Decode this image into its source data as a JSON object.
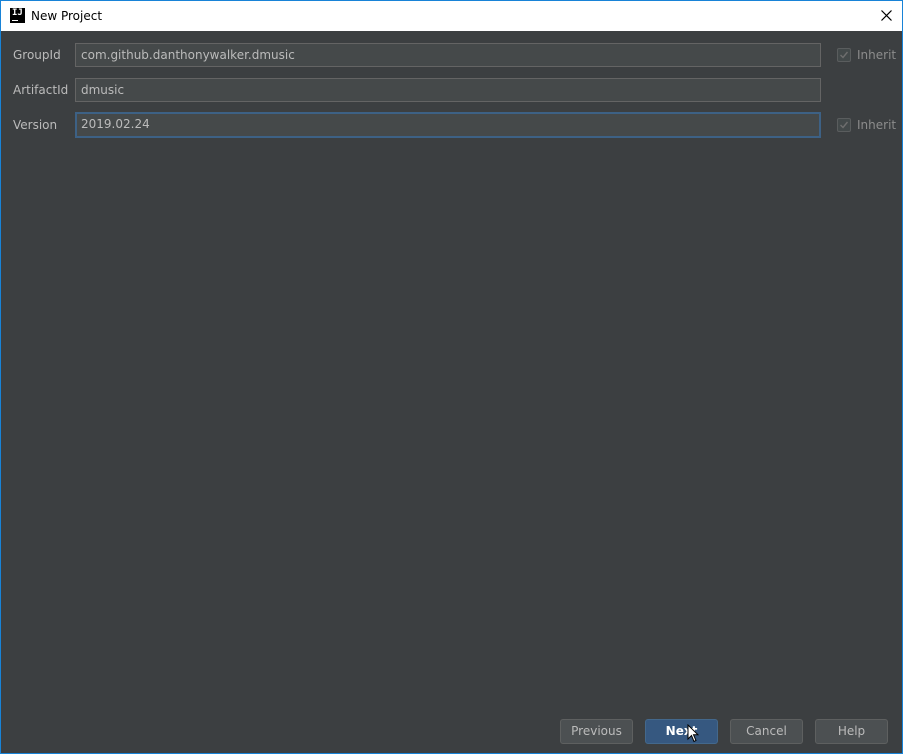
{
  "window": {
    "title": "New Project",
    "app_icon_text": "IJ"
  },
  "form": {
    "group_id": {
      "label": "GroupId",
      "value": "com.github.danthonywalker.dmusic",
      "inherit_label": "Inherit",
      "inherit_checked": true
    },
    "artifact_id": {
      "label": "ArtifactId",
      "value": "dmusic"
    },
    "version": {
      "label": "Version",
      "value": "2019.02.24",
      "inherit_label": "Inherit",
      "inherit_checked": true
    }
  },
  "buttons": {
    "previous": "Previous",
    "next": "Next",
    "cancel": "Cancel",
    "help": "Help"
  },
  "colors": {
    "background": "#3c3f41",
    "primary_button": "#365880",
    "focus_border": "#3d6185"
  }
}
